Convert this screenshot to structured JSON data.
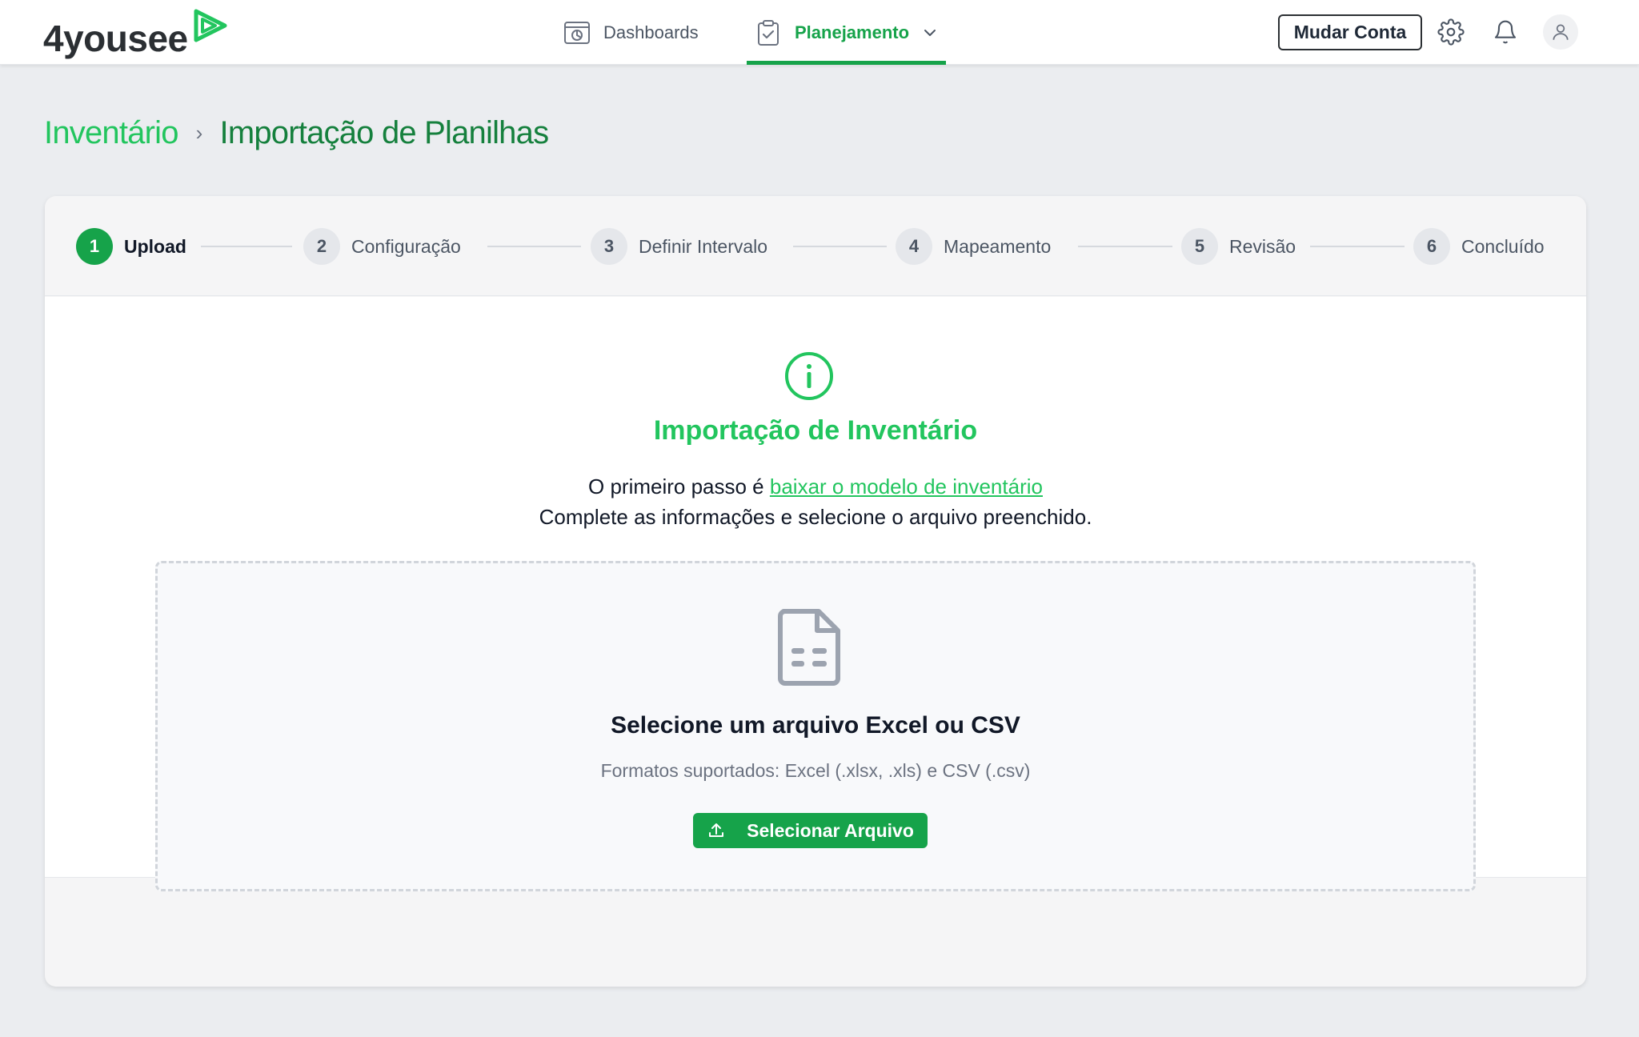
{
  "app": {
    "logo_text": "4yousee"
  },
  "nav": {
    "items": [
      {
        "label": "Dashboards",
        "icon": "dashboard-icon"
      },
      {
        "label": "Planejamento",
        "icon": "clipboard-check-icon",
        "active": true
      }
    ]
  },
  "header": {
    "switch_account_label": "Mudar Conta",
    "icons": [
      "gear-icon",
      "bell-icon",
      "user-icon"
    ]
  },
  "breadcrumb": {
    "parent": "Inventário",
    "separator": "›",
    "current": "Importação de Planilhas"
  },
  "stepper": {
    "steps": [
      {
        "number": "1",
        "label": "Upload",
        "active": true
      },
      {
        "number": "2",
        "label": "Configuração"
      },
      {
        "number": "3",
        "label": "Definir Intervalo"
      },
      {
        "number": "4",
        "label": "Mapeamento"
      },
      {
        "number": "5",
        "label": "Revisão"
      },
      {
        "number": "6",
        "label": "Concluído"
      }
    ]
  },
  "main": {
    "title": "Importação de Inventário",
    "desc_prefix": "O primeiro passo é ",
    "desc_link": "baixar o modelo de inventário",
    "desc_line2": "Complete as informações e selecione o arquivo preenchido."
  },
  "dropzone": {
    "title": "Selecione um arquivo Excel ou CSV",
    "subtitle": "Formatos suportados: Excel (.xlsx, .xls) e CSV (.csv)",
    "button_label": "Selecionar Arquivo"
  },
  "colors": {
    "brand_green": "#16a34a",
    "accent_green": "#22c55e",
    "background": "#ebedf0"
  }
}
